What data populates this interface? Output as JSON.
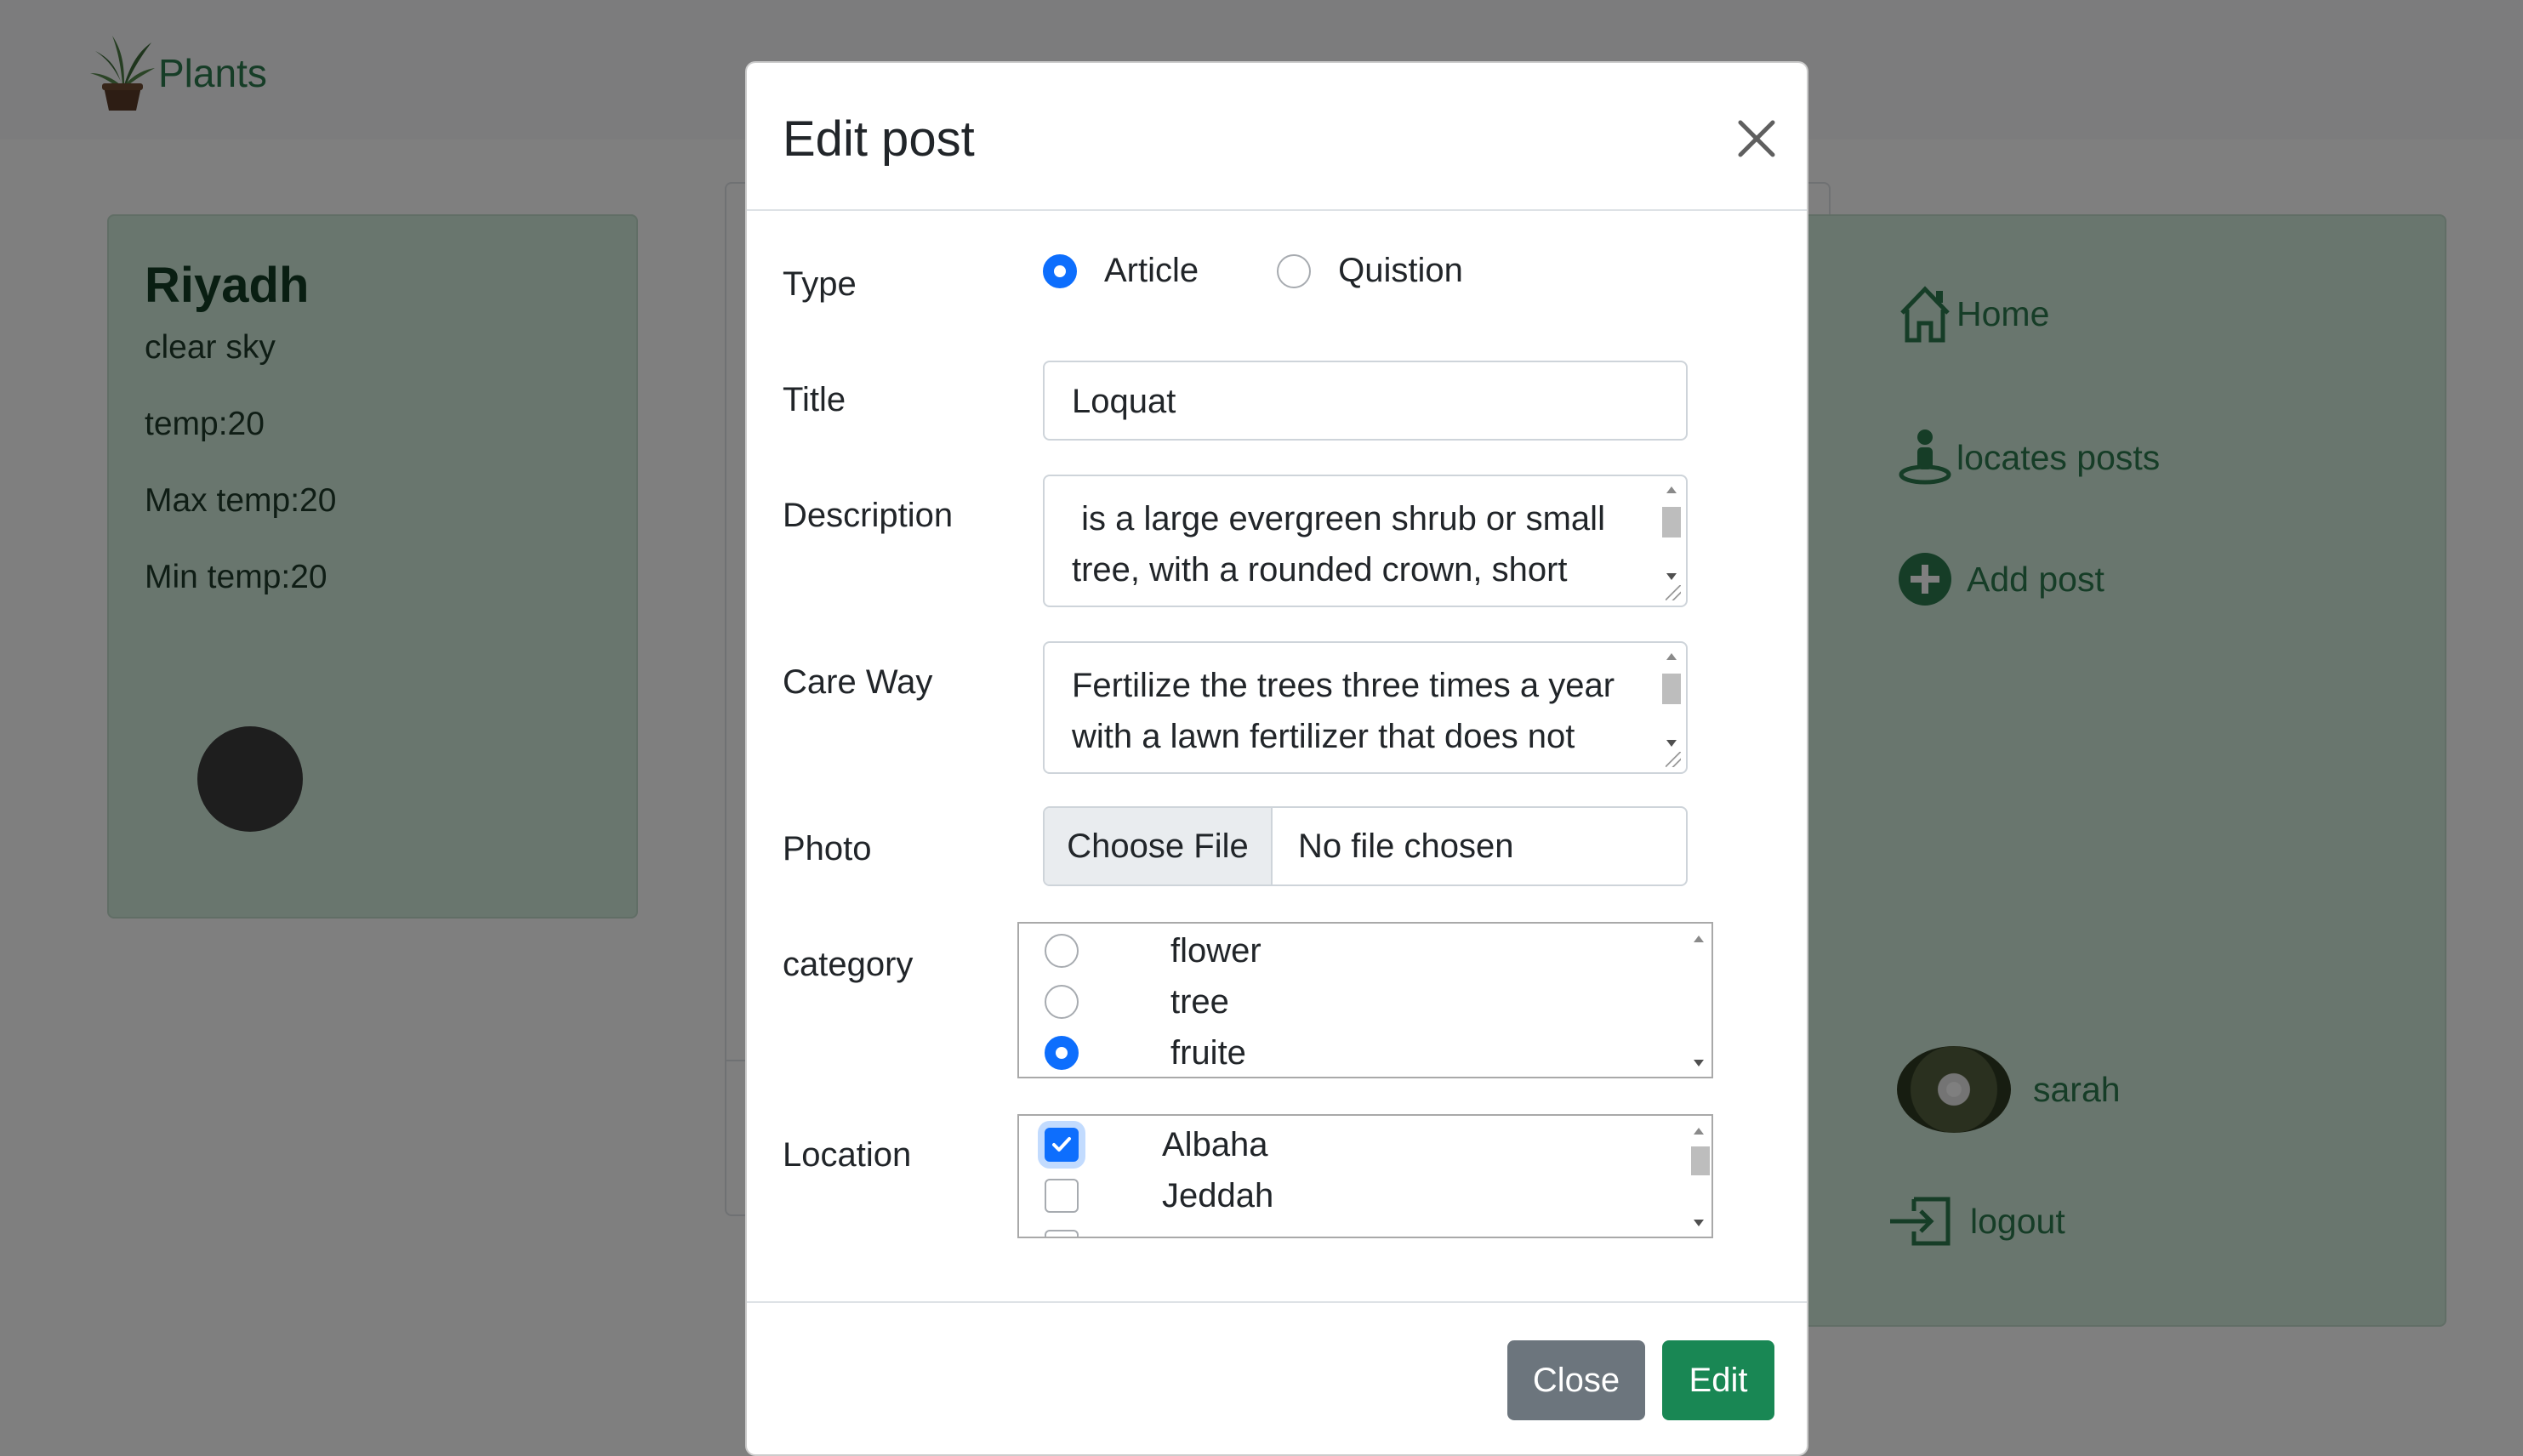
{
  "brand": {
    "name": "Plants"
  },
  "weather": {
    "city": "Riyadh",
    "description": "clear sky",
    "temp": "temp:20",
    "max_temp": "Max temp:20",
    "min_temp": "Min temp:20"
  },
  "nav": {
    "home": "Home",
    "locates_posts": "locates posts",
    "add_post": "Add post",
    "user": "sarah",
    "logout": "logout"
  },
  "modal": {
    "title": "Edit post",
    "labels": {
      "type": "Type",
      "title": "Title",
      "description": "Description",
      "care_way": "Care Way",
      "photo": "Photo",
      "category": "category",
      "location": "Location"
    },
    "type_options": [
      {
        "label": "Article",
        "checked": true
      },
      {
        "label": "Quistion",
        "checked": false
      }
    ],
    "title_value": "Loquat",
    "description_lines": [
      " is a large evergreen shrub or small",
      "tree, with a rounded crown, short"
    ],
    "care_way_lines": [
      "Fertilize the trees three times a year",
      "with a lawn fertilizer that does not"
    ],
    "photo": {
      "button": "Choose File",
      "status": "No file chosen"
    },
    "categories": [
      {
        "label": "flower",
        "checked": false
      },
      {
        "label": "tree",
        "checked": false
      },
      {
        "label": "fruite",
        "checked": true
      }
    ],
    "locations": [
      {
        "label": "Albaha",
        "checked": true
      },
      {
        "label": "Jeddah",
        "checked": false
      }
    ],
    "buttons": {
      "close": "Close",
      "edit": "Edit"
    }
  },
  "colors": {
    "accent": "#0d6efd",
    "brand_green": "#2d7a4f",
    "edit_button": "#198754",
    "close_button": "#6c757d"
  }
}
